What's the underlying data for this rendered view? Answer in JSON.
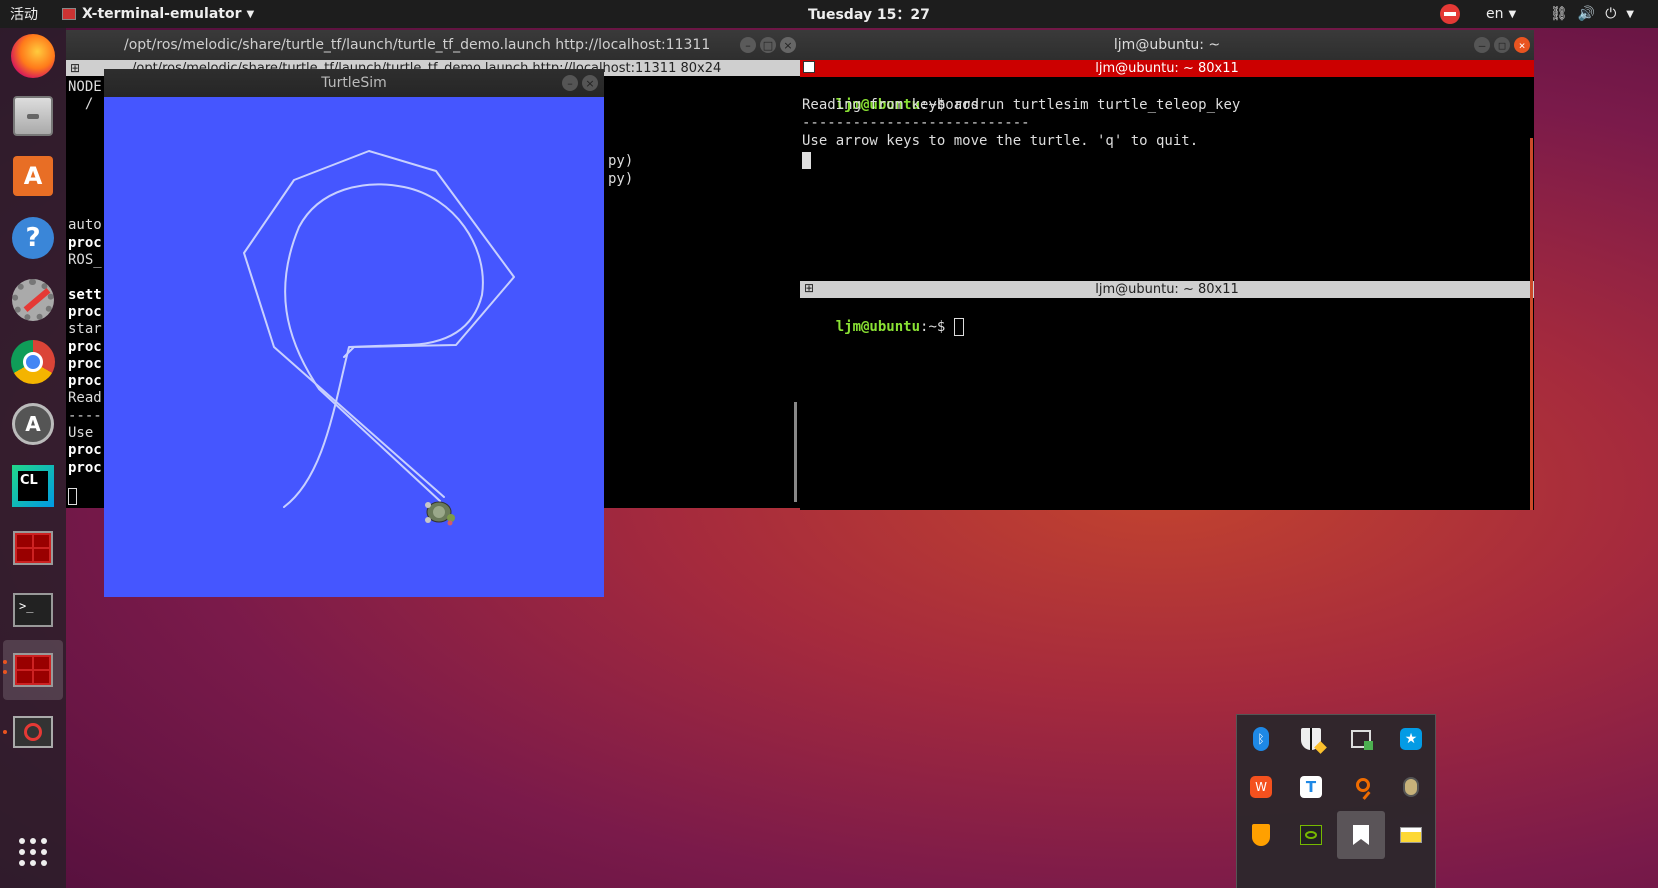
{
  "topbar": {
    "activities": "活动",
    "app_name": "X-terminal-emulator",
    "clock": "Tuesday 15：27",
    "lang": "en"
  },
  "dock": {
    "items": [
      "firefox-icon",
      "files-icon",
      "software-center-icon",
      "help-icon",
      "settings-icon",
      "chrome-icon",
      "software-updater-icon",
      "clion-icon",
      "terminator-icon",
      "terminal-icon",
      "terminator-active-icon",
      "error-app-icon",
      "app-grid-icon"
    ]
  },
  "left_terminal": {
    "title": "/opt/ros/melodic/share/turtle_tf/launch/turtle_tf_demo.launch http://localhost:11311",
    "subtitle": "/opt/ros/melodic/share/turtle_tf/launch/turtle_tf_demo.launch http://localhost:11311 80x24",
    "lines": [
      {
        "text": "NODE",
        "bold": false
      },
      {
        "text": "  /",
        "bold": false
      },
      {
        "text": "",
        "bold": false
      },
      {
        "text": "",
        "bold": false
      },
      {
        "text": "",
        "bold": false
      },
      {
        "text": "",
        "bold": false
      },
      {
        "text": "",
        "bold": false
      },
      {
        "text": "",
        "bold": false
      },
      {
        "text": "auto",
        "bold": false
      },
      {
        "text": "proc",
        "bold": true
      },
      {
        "text": "ROS_",
        "bold": false
      },
      {
        "text": "",
        "bold": false
      },
      {
        "text": "sett",
        "bold": true
      },
      {
        "text": "proc",
        "bold": true
      },
      {
        "text": "star",
        "bold": false
      },
      {
        "text": "proc",
        "bold": true
      },
      {
        "text": "proc",
        "bold": true
      },
      {
        "text": "proc",
        "bold": true
      },
      {
        "text": "Read",
        "bold": false
      },
      {
        "text": "----",
        "bold": false
      },
      {
        "text": "Use ",
        "bold": false
      },
      {
        "text": "proc",
        "bold": true
      },
      {
        "text": "proc",
        "bold": true
      }
    ],
    "right_fragments": [
      "py)",
      "py)"
    ]
  },
  "turtlesim": {
    "title": "TurtleSim"
  },
  "right_terminal": {
    "title": "ljm@ubuntu: ~",
    "pane1_bar": "ljm@ubuntu: ~ 80x11",
    "pane1_prompt": "ljm@ubuntu",
    "pane1_path": ":~$ ",
    "pane1_cmd": "rosrun turtlesim turtle_teleop_key",
    "pane1_lines": [
      "Reading from keyboard",
      "---------------------------",
      "Use arrow keys to move the turtle. 'q' to quit."
    ],
    "pane2_bar": "ljm@ubuntu: ~ 80x11",
    "pane2_prompt": "ljm@ubuntu",
    "pane2_path": ":~$ "
  },
  "tray": {
    "icons": [
      "bluetooth-icon",
      "shield-warning-icon",
      "screen-share-icon",
      "star-app-icon",
      "wps-icon",
      "teamviewer-icon",
      "search-orange-icon",
      "bug-icon",
      "vpn-shield-icon",
      "nvidia-icon",
      "bookmark-icon",
      "window-icon"
    ]
  },
  "colors": {
    "accent": "#e95420",
    "turtle_bg": "#4556ff",
    "prompt_green": "#8ae234",
    "active_bar_red": "#cc0000"
  }
}
